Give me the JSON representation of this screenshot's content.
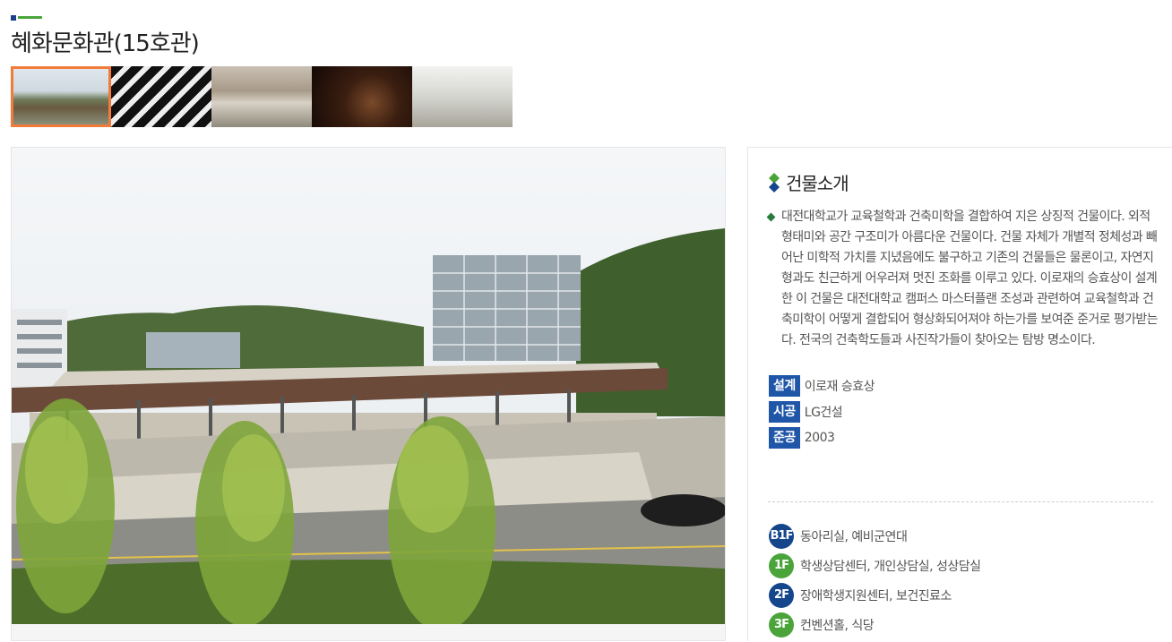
{
  "page": {
    "title": "혜화문화관(15호관)"
  },
  "thumbnails": [
    {
      "name": "exterior-view",
      "active": true
    },
    {
      "name": "striped-interior"
    },
    {
      "name": "study-lounge"
    },
    {
      "name": "dark-hall"
    },
    {
      "name": "white-gallery"
    }
  ],
  "colors": {
    "accent_orange": "#f27b3a",
    "label_blue": "#1f56a8",
    "floor_navy": "#15468c",
    "floor_green": "#4aa43a"
  },
  "intro": {
    "heading": "건물소개",
    "description": "대전대학교가 교육철학과 건축미학을 결합하여 지은 상징적 건물이다. 외적 형태미와 공간 구조미가 아름다운 건물이다. 건물 자체가 개별적 정체성과 빼어난 미학적 가치를 지녔음에도 불구하고 기존의 건물들은 물론이고, 자연지형과도 친근하게 어우러져 멋진 조화를 이루고 있다. 이로재의 승효상이 설계한 이 건물은 대전대학교 캠퍼스 마스터플랜 조성과 관련하여 교육철학과 건축미학이 어떻게 결합되어 형상화되어져야 하는가를 보여준 준거로 평가받는다. 전국의 건축학도들과 사진작가들이 찾아오는 탐방 명소이다.",
    "meta": [
      {
        "label": "설계",
        "value": "이로재 승효상"
      },
      {
        "label": "시공",
        "value": "LG건설"
      },
      {
        "label": "준공",
        "value": "2003"
      }
    ]
  },
  "floors": [
    {
      "badge": "B1F",
      "color": "navy",
      "rooms": "동아리실, 예비군연대"
    },
    {
      "badge": "1F",
      "color": "green",
      "rooms": "학생상담센터, 개인상담실, 성상담실"
    },
    {
      "badge": "2F",
      "color": "navy",
      "rooms": "장애학생지원센터, 보건진료소"
    },
    {
      "badge": "3F",
      "color": "green",
      "rooms": "컨벤션홀, 식당"
    }
  ]
}
